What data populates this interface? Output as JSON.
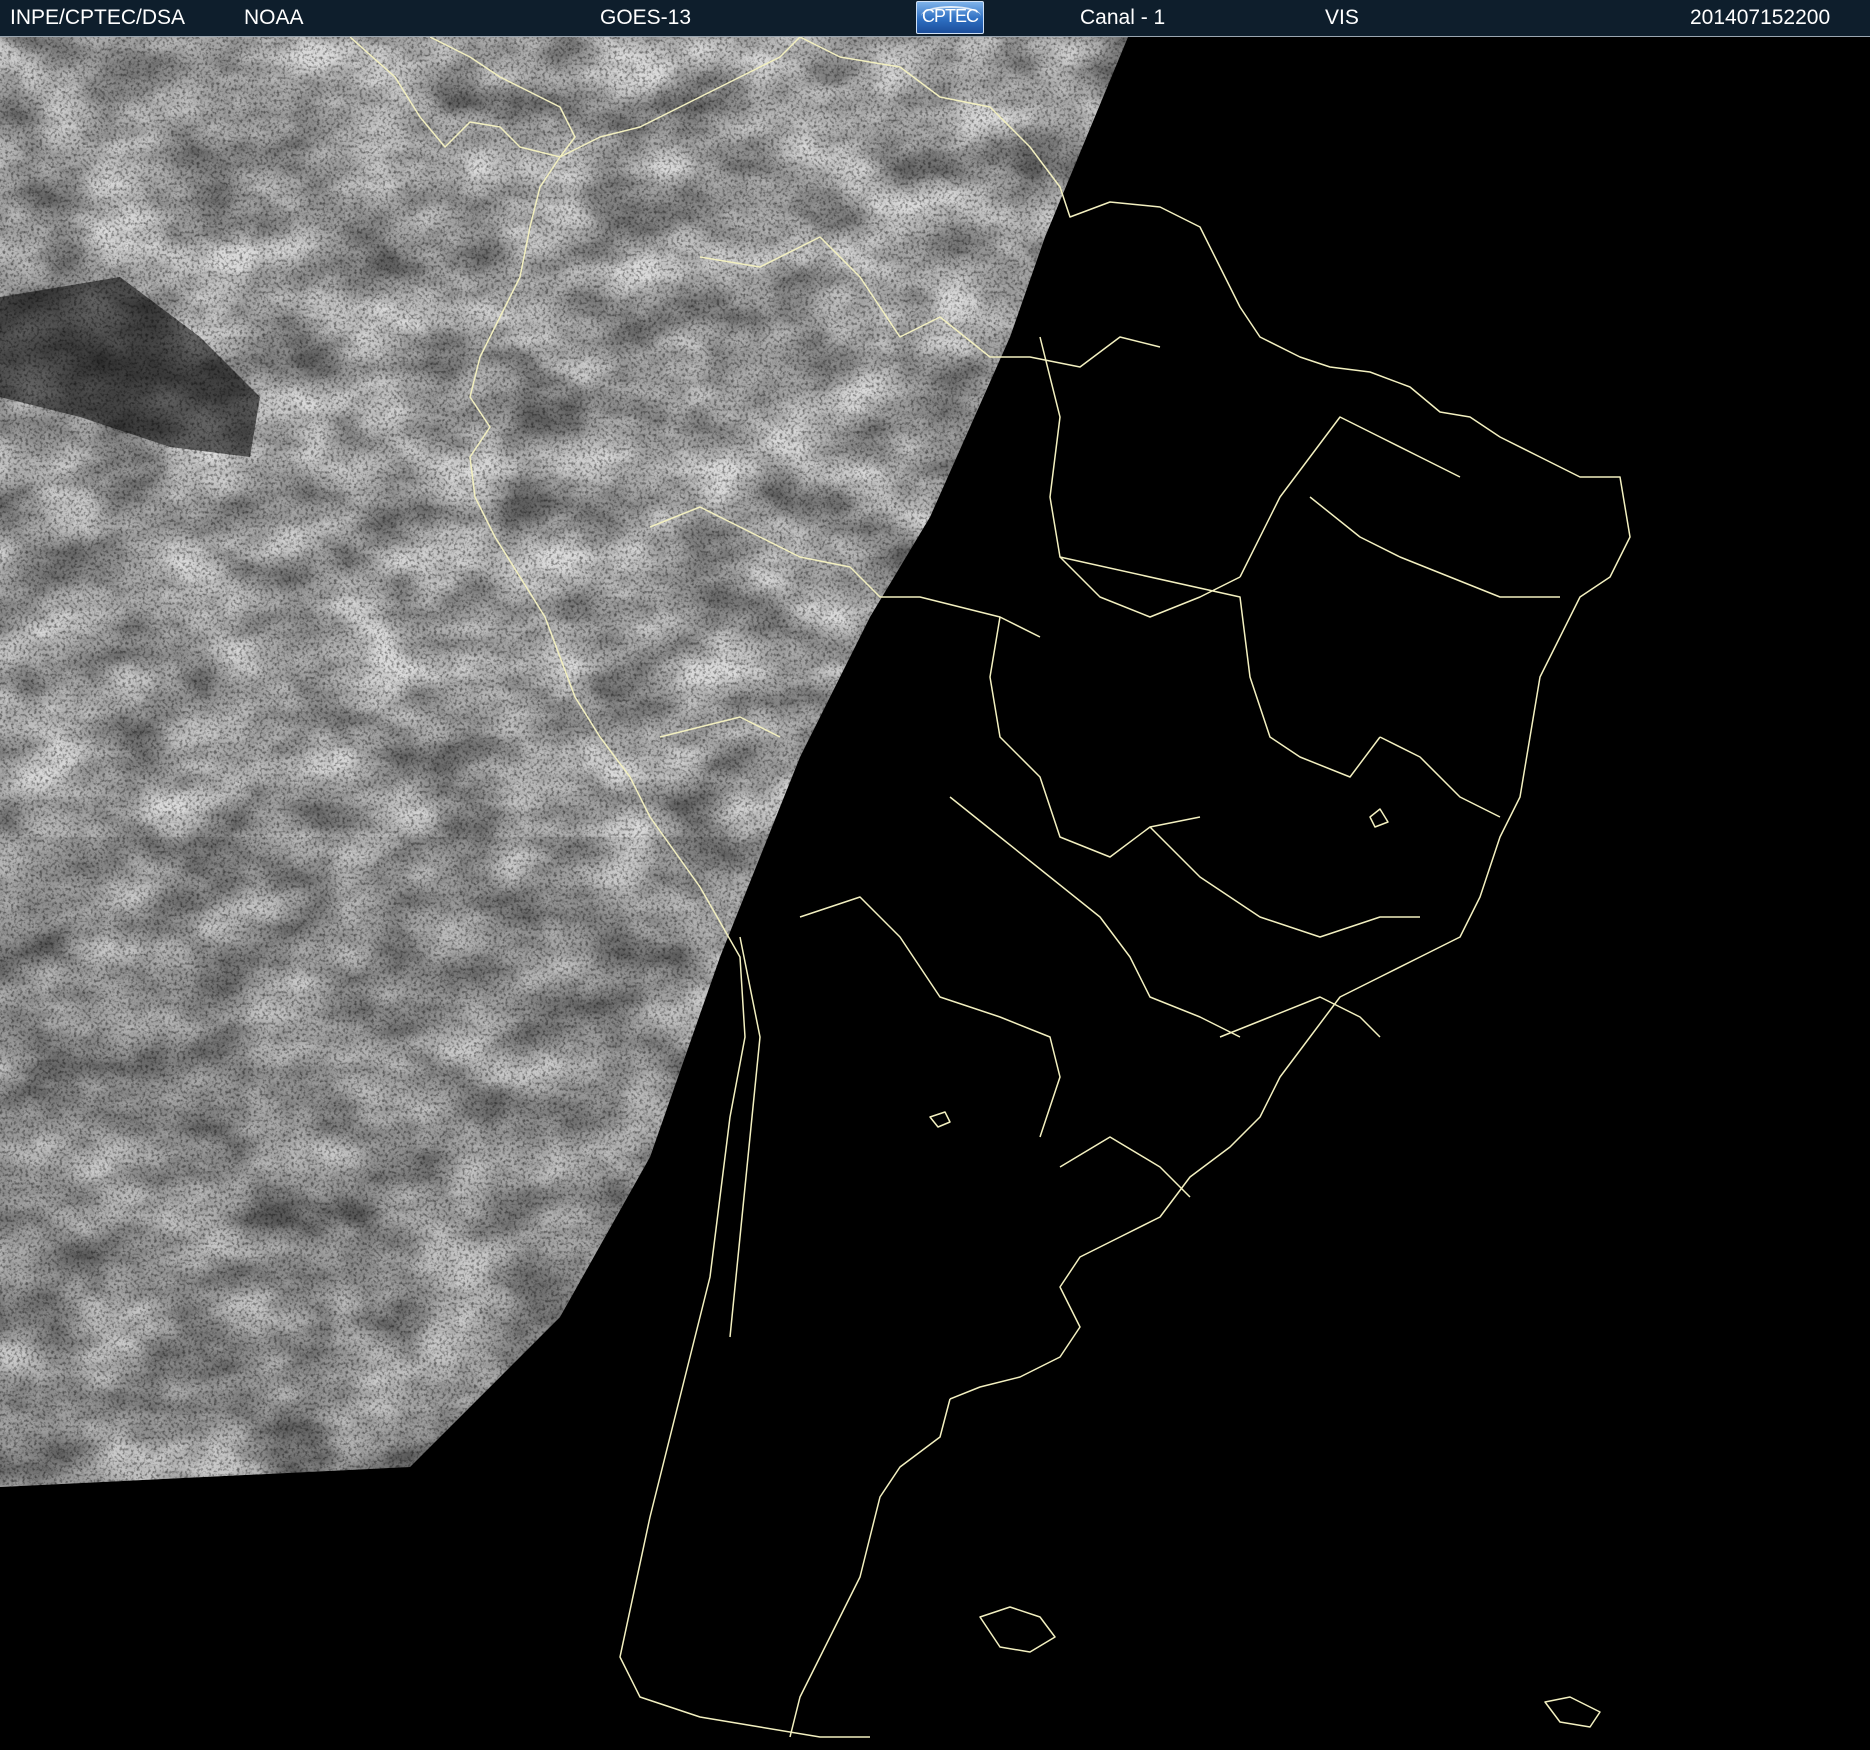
{
  "header": {
    "agency": "INPE/CPTEC/DSA",
    "partner": "NOAA",
    "satellite": "GOES-13",
    "logo_text": "CPTEC",
    "channel": "Canal - 1",
    "band": "VIS",
    "timestamp": "201407152200"
  },
  "colors": {
    "header_background": "#0e1e2c",
    "borders": "#f3f0c0",
    "night_side": "#000000",
    "day_side_clouds": "#8a8a8a"
  },
  "icons": {
    "logo": "cptec-logo-icon"
  }
}
